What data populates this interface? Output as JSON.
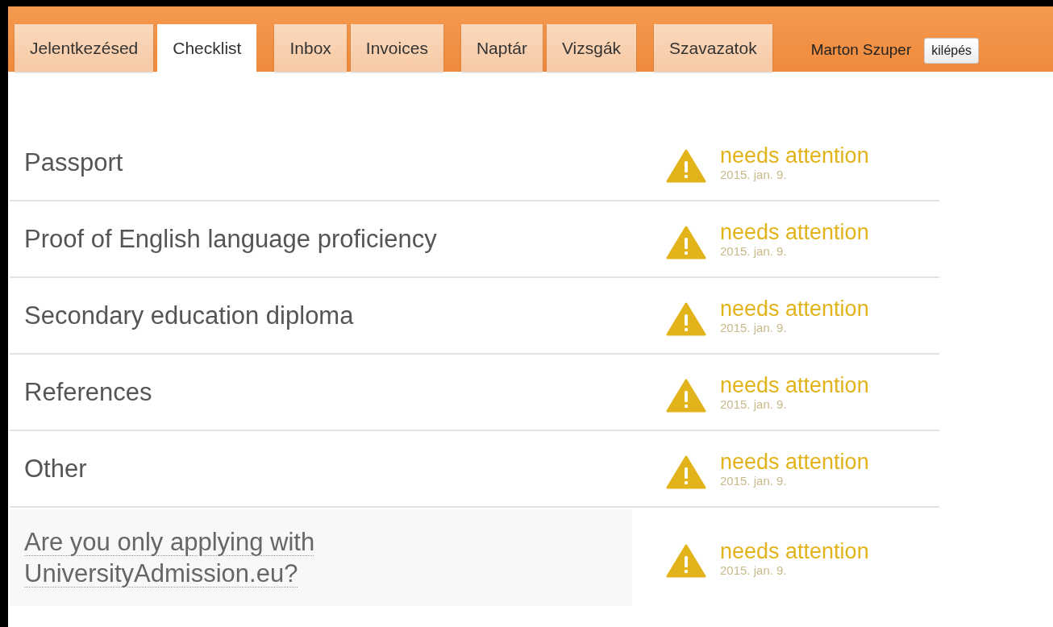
{
  "tab_groups": [
    [
      {
        "label": "Jelentkezésed",
        "selected": false
      },
      {
        "label": "Checklist",
        "selected": true
      }
    ],
    [
      {
        "label": "Inbox",
        "selected": false
      },
      {
        "label": "Invoices",
        "selected": false
      }
    ],
    [
      {
        "label": "Naptár",
        "selected": false
      },
      {
        "label": "Vizsgák",
        "selected": false
      }
    ],
    [
      {
        "label": "Szavazatok",
        "selected": false
      }
    ]
  ],
  "user": {
    "name": "Marton Szuper",
    "logout": "kilépés"
  },
  "checklist": [
    {
      "kind": "document",
      "label": "Passport",
      "attention": true,
      "status": "needs attention",
      "date": "2015. jan. 9."
    },
    {
      "kind": "document",
      "label": "Proof of English language proficiency",
      "attention": true,
      "status": "needs attention",
      "date": "2015. jan. 9."
    },
    {
      "kind": "document",
      "label": "Secondary education diploma",
      "attention": true,
      "status": "needs attention",
      "date": "2015. jan. 9."
    },
    {
      "kind": "document",
      "label": "References",
      "attention": true,
      "status": "needs attention",
      "date": "2015. jan. 9."
    },
    {
      "kind": "document",
      "label": "Other",
      "attention": true,
      "status": "needs attention",
      "date": "2015. jan. 9."
    },
    {
      "kind": "question",
      "label": "Are you only applying with UniversityAdmission.eu?",
      "attention": true,
      "status": "needs attention",
      "date": "2015. jan. 9."
    }
  ]
}
